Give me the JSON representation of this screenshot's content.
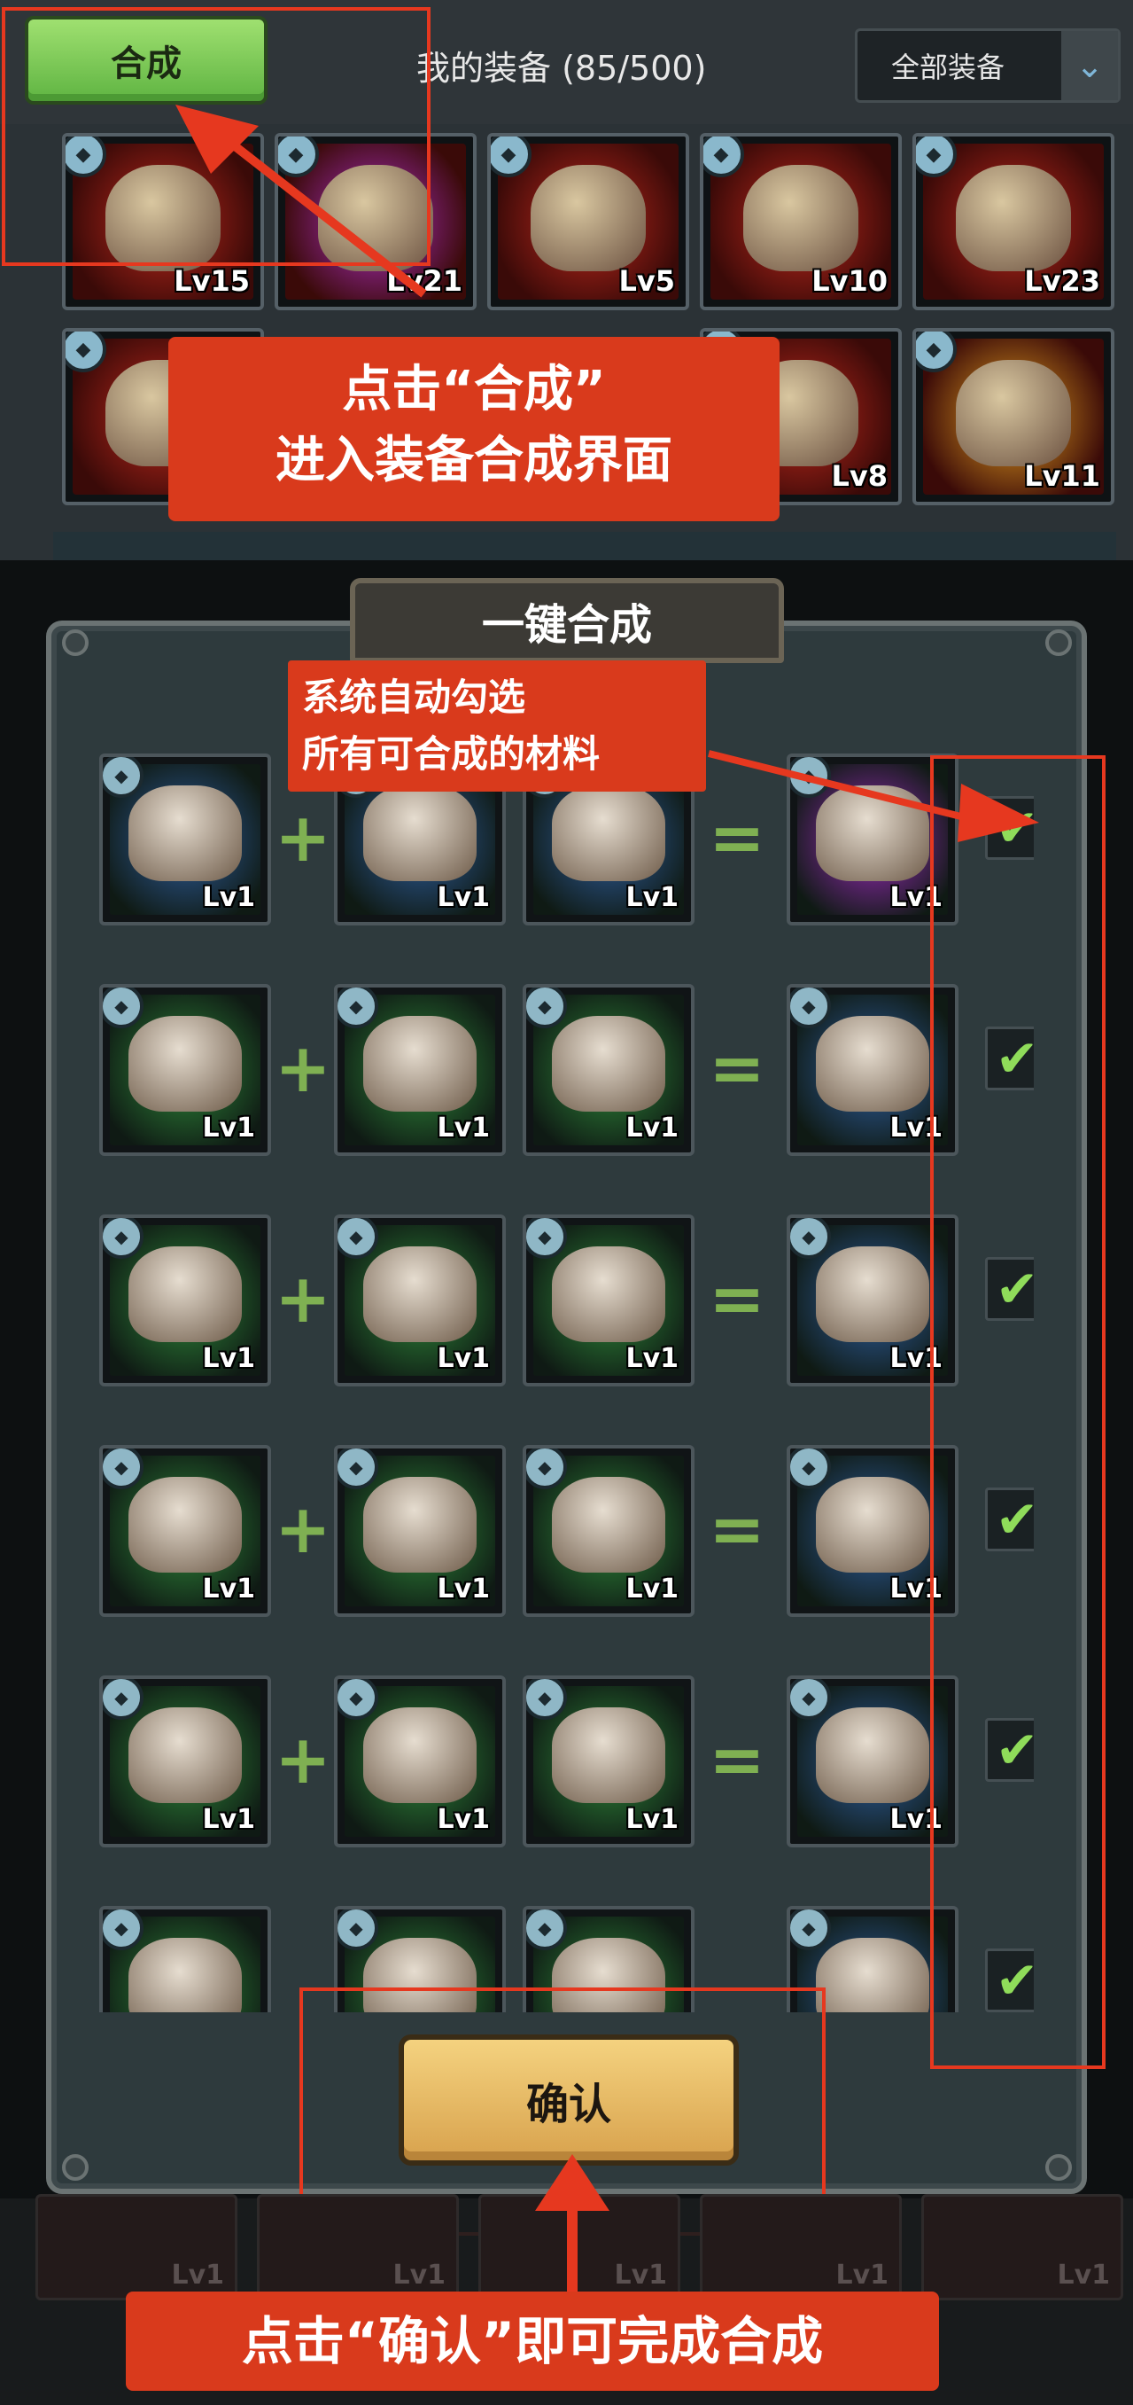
{
  "top_panel": {
    "synth_button": "合成",
    "equip_title": "我的装备 (85/500)",
    "filter": {
      "selected": "全部装备",
      "icon": "chevron-down-icon"
    },
    "items": [
      {
        "level": "Lv15",
        "badge_icon": "helmet-icon",
        "color": "#c0281c"
      },
      {
        "level": "Lv21",
        "badge_icon": "helmet-icon",
        "color": "#b030c8"
      },
      {
        "level": "Lv5",
        "badge_icon": "armor-icon",
        "color": "#c0281c"
      },
      {
        "level": "Lv10",
        "badge_icon": "necklace-icon",
        "color": "#c0281c"
      },
      {
        "level": "Lv23",
        "badge_icon": "sword-icon",
        "color": "#c0281c"
      },
      {
        "level": "",
        "badge_icon": "helmet-icon",
        "color": "#c0281c"
      },
      {
        "level": "Lv8",
        "badge_icon": "ring-icon",
        "color": "#c0281c"
      },
      {
        "level": "Lv11",
        "badge_icon": "crown-icon",
        "color": "#e6a020"
      }
    ],
    "note": "点击“合成”\n进入装备合成界面"
  },
  "dialog": {
    "title": "一键合成",
    "note": "系统自动勾选\n所有可合成的材料",
    "rows": [
      {
        "input_level": "Lv1",
        "input_color": "#2f5ea0",
        "result_color": "#a02bc0",
        "input_icon": "helmet-icon",
        "result_icon": "glove-icon",
        "op_plus": "+",
        "op_eq": "=",
        "checked": "✔"
      },
      {
        "input_level": "Lv1",
        "input_color": "#2f8a3a",
        "result_color": "#2f5ea0",
        "input_icon": "mask-icon",
        "result_icon": "shield-icon",
        "op_plus": "+",
        "op_eq": "=",
        "checked": "✔"
      },
      {
        "input_level": "Lv1",
        "input_color": "#2f8a3a",
        "result_color": "#2f5ea0",
        "input_icon": "armor-icon",
        "result_icon": "armor-icon",
        "op_plus": "+",
        "op_eq": "=",
        "checked": "✔"
      },
      {
        "input_level": "Lv1",
        "input_color": "#2f8a3a",
        "result_color": "#2f5ea0",
        "input_icon": "sword-icon",
        "result_icon": "sword-icon",
        "op_plus": "+",
        "op_eq": "=",
        "checked": "✔"
      },
      {
        "input_level": "Lv1",
        "input_color": "#2f8a3a",
        "result_color": "#2f5ea0",
        "input_icon": "boots-icon",
        "result_icon": "boots-icon",
        "op_plus": "+",
        "op_eq": "=",
        "checked": "✔"
      },
      {
        "input_level": "",
        "input_color": "#2f8a3a",
        "result_color": "#2f5ea0",
        "input_icon": "boots-icon",
        "result_icon": "boots-icon",
        "op_plus": "",
        "op_eq": "",
        "checked": "✔"
      }
    ],
    "confirm_button": "确认"
  },
  "bottom": {
    "ghost_levels": [
      "Lv1",
      "Lv1",
      "Lv1",
      "Lv1",
      "Lv1"
    ],
    "note": "点击“确认”即可完成合成"
  }
}
